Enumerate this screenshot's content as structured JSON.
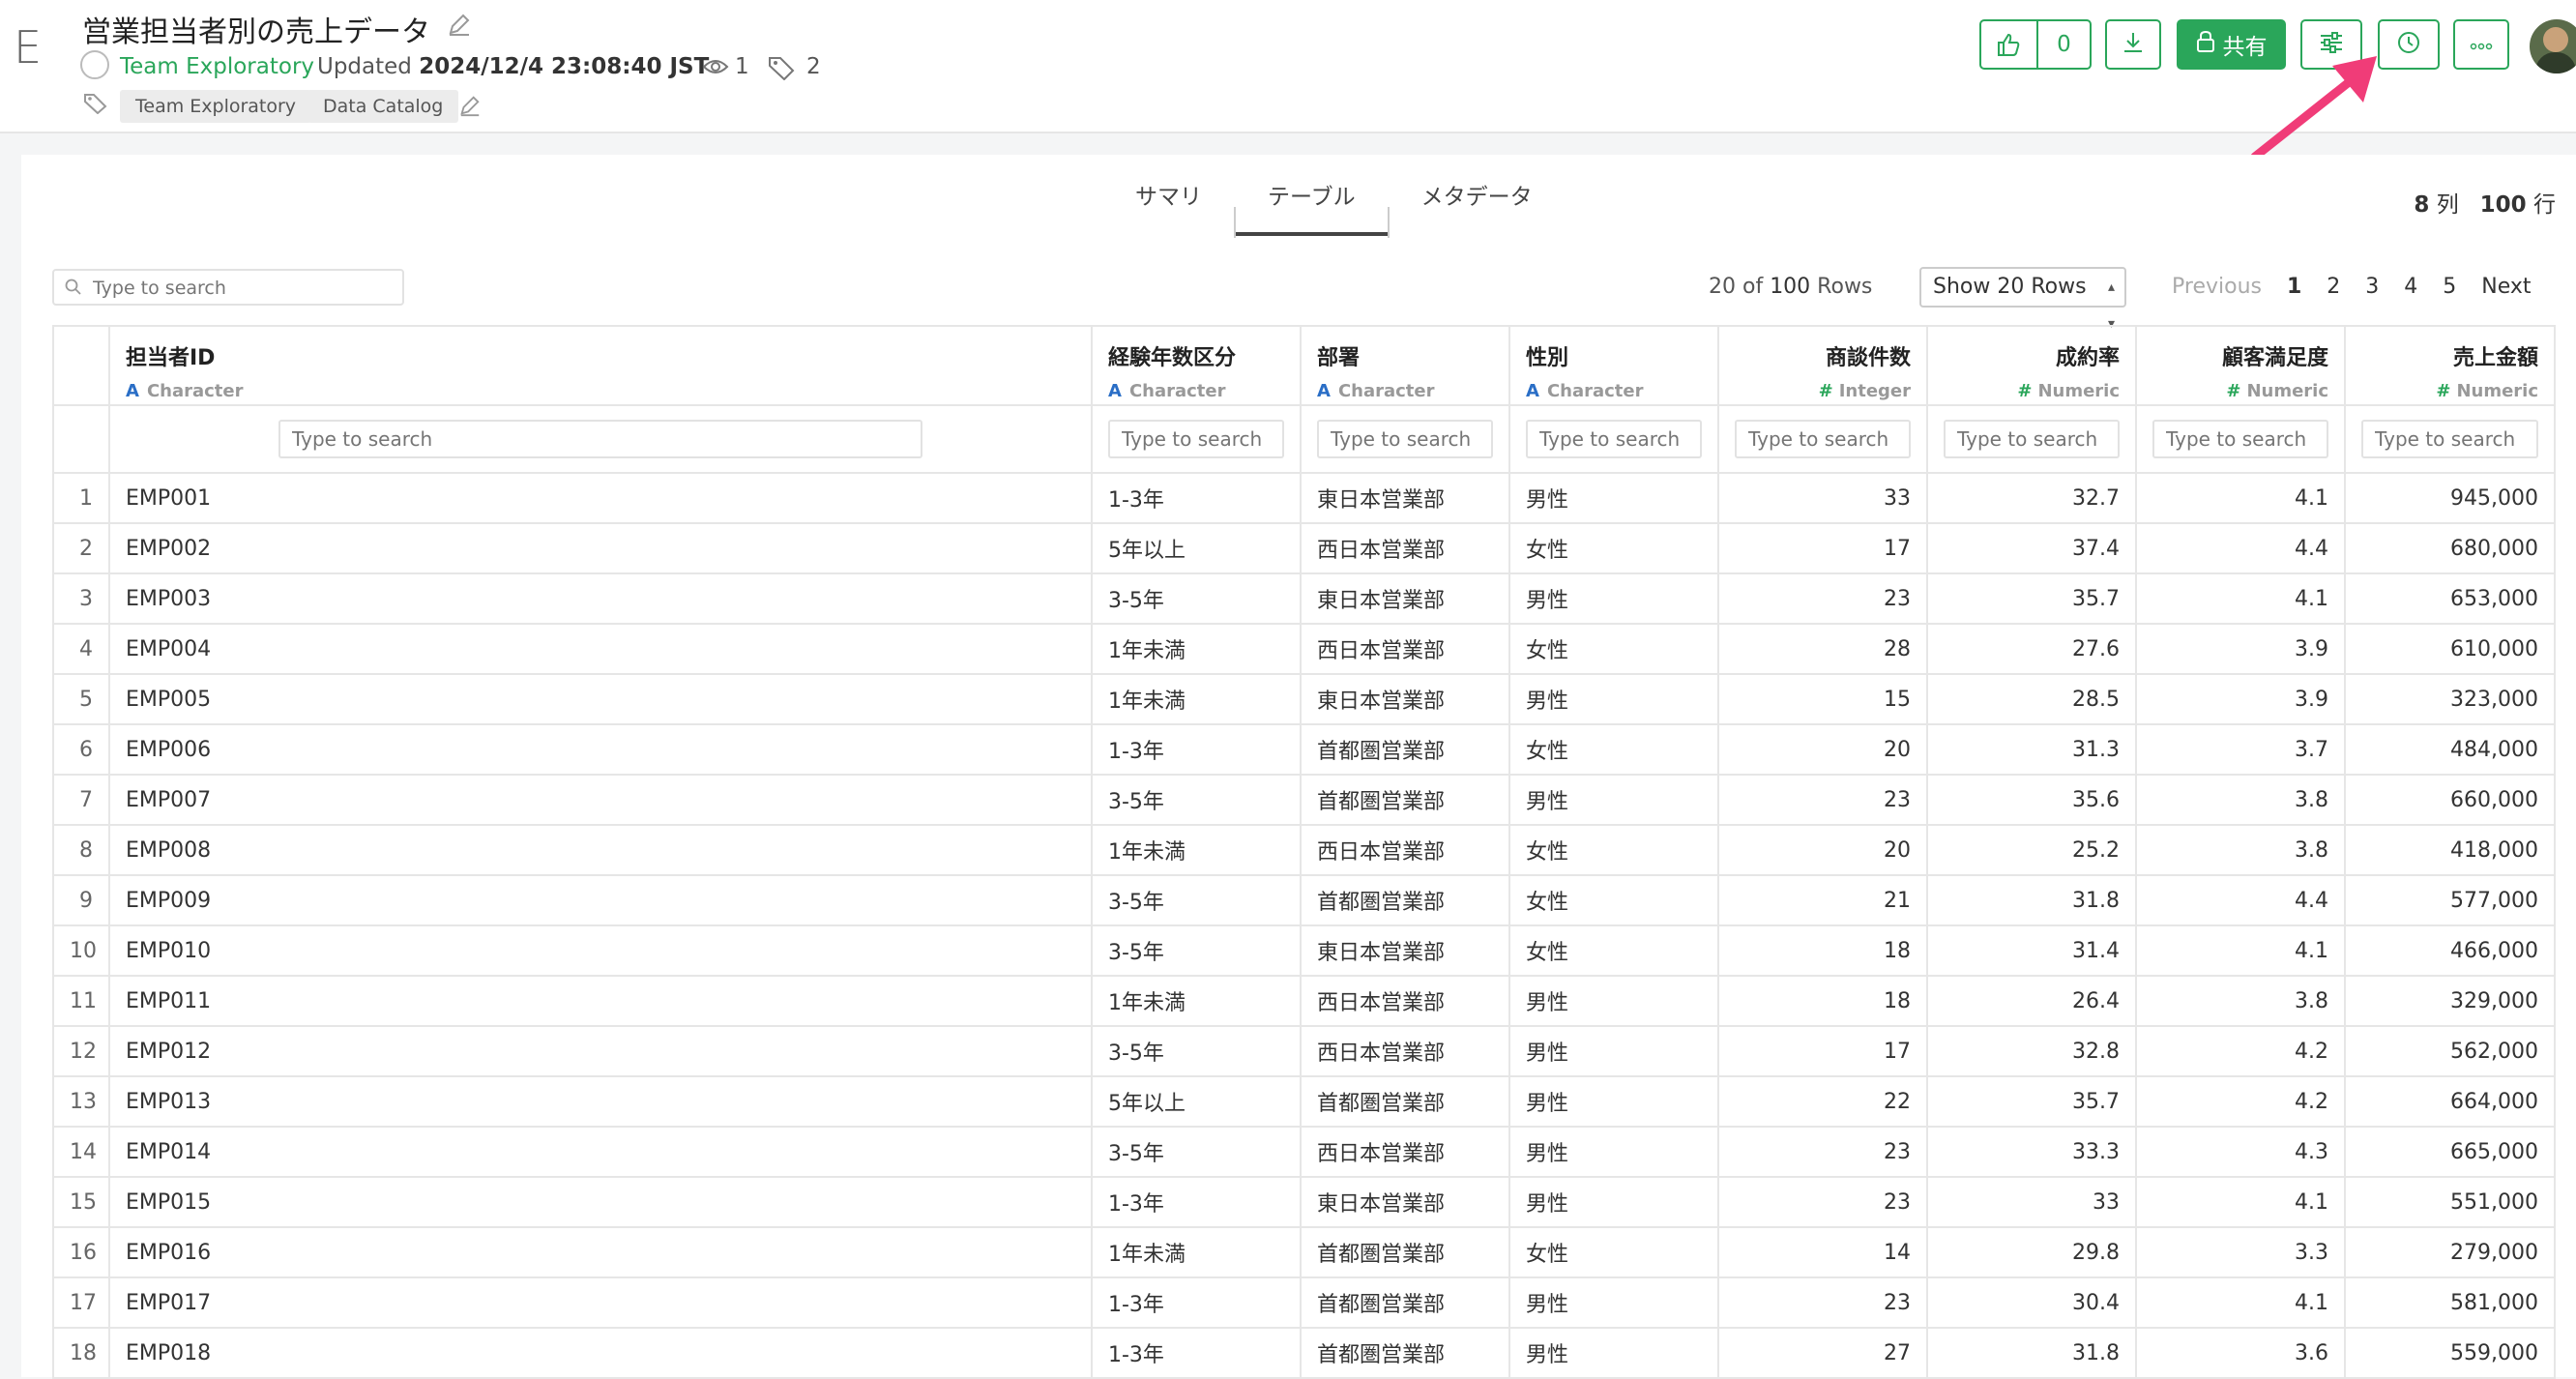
{
  "header": {
    "logo_letter": "E",
    "title": "営業担当者別の売上データ",
    "team": "Team Exploratory",
    "updated_label": "Updated",
    "updated_value": "2024/12/4 23:08:40 JST",
    "views": "1",
    "tags_count": "2",
    "tags": [
      "Team Exploratory",
      "Data Catalog"
    ],
    "like_count": "0",
    "share_label": "共有"
  },
  "tabs": [
    "サマリ",
    "テーブル",
    "メタデータ"
  ],
  "dims": {
    "cols": "8",
    "cols_unit": "列",
    "rows": "100",
    "rows_unit": "行"
  },
  "toolbar": {
    "search_placeholder": "Type to search",
    "row_count_prefix": "20 of ",
    "row_count_total": "100",
    "row_count_suffix": " Rows",
    "page_size": "Show 20 Rows",
    "previous": "Previous",
    "pages": [
      "1",
      "2",
      "3",
      "4",
      "5"
    ],
    "next": "Next"
  },
  "columns": [
    {
      "name": "担当者ID",
      "type": "Character",
      "kind": "A"
    },
    {
      "name": "経験年数区分",
      "type": "Character",
      "kind": "A"
    },
    {
      "name": "部署",
      "type": "Character",
      "kind": "A"
    },
    {
      "name": "性別",
      "type": "Character",
      "kind": "A"
    },
    {
      "name": "商談件数",
      "type": "Integer",
      "kind": "#"
    },
    {
      "name": "成約率",
      "type": "Numeric",
      "kind": "#"
    },
    {
      "name": "顧客満足度",
      "type": "Numeric",
      "kind": "#"
    },
    {
      "name": "売上金額",
      "type": "Numeric",
      "kind": "#"
    }
  ],
  "filter_placeholder": "Type to search",
  "rows": [
    [
      "1",
      "EMP001",
      "1-3年",
      "東日本営業部",
      "男性",
      "33",
      "32.7",
      "4.1",
      "945,000"
    ],
    [
      "2",
      "EMP002",
      "5年以上",
      "西日本営業部",
      "女性",
      "17",
      "37.4",
      "4.4",
      "680,000"
    ],
    [
      "3",
      "EMP003",
      "3-5年",
      "東日本営業部",
      "男性",
      "23",
      "35.7",
      "4.1",
      "653,000"
    ],
    [
      "4",
      "EMP004",
      "1年未満",
      "西日本営業部",
      "女性",
      "28",
      "27.6",
      "3.9",
      "610,000"
    ],
    [
      "5",
      "EMP005",
      "1年未満",
      "東日本営業部",
      "男性",
      "15",
      "28.5",
      "3.9",
      "323,000"
    ],
    [
      "6",
      "EMP006",
      "1-3年",
      "首都圏営業部",
      "女性",
      "20",
      "31.3",
      "3.7",
      "484,000"
    ],
    [
      "7",
      "EMP007",
      "3-5年",
      "首都圏営業部",
      "男性",
      "23",
      "35.6",
      "3.8",
      "660,000"
    ],
    [
      "8",
      "EMP008",
      "1年未満",
      "西日本営業部",
      "女性",
      "20",
      "25.2",
      "3.8",
      "418,000"
    ],
    [
      "9",
      "EMP009",
      "3-5年",
      "首都圏営業部",
      "女性",
      "21",
      "31.8",
      "4.4",
      "577,000"
    ],
    [
      "10",
      "EMP010",
      "3-5年",
      "東日本営業部",
      "女性",
      "18",
      "31.4",
      "4.1",
      "466,000"
    ],
    [
      "11",
      "EMP011",
      "1年未満",
      "西日本営業部",
      "男性",
      "18",
      "26.4",
      "3.8",
      "329,000"
    ],
    [
      "12",
      "EMP012",
      "3-5年",
      "西日本営業部",
      "男性",
      "17",
      "32.8",
      "4.2",
      "562,000"
    ],
    [
      "13",
      "EMP013",
      "5年以上",
      "首都圏営業部",
      "男性",
      "22",
      "35.7",
      "4.2",
      "664,000"
    ],
    [
      "14",
      "EMP014",
      "3-5年",
      "西日本営業部",
      "男性",
      "23",
      "33.3",
      "4.3",
      "665,000"
    ],
    [
      "15",
      "EMP015",
      "1-3年",
      "東日本営業部",
      "男性",
      "23",
      "33",
      "4.1",
      "551,000"
    ],
    [
      "16",
      "EMP016",
      "1年未満",
      "首都圏営業部",
      "女性",
      "14",
      "29.8",
      "3.3",
      "279,000"
    ],
    [
      "17",
      "EMP017",
      "1-3年",
      "首都圏営業部",
      "男性",
      "23",
      "30.4",
      "4.1",
      "581,000"
    ],
    [
      "18",
      "EMP018",
      "1-3年",
      "首都圏営業部",
      "男性",
      "27",
      "31.8",
      "3.6",
      "559,000"
    ]
  ]
}
